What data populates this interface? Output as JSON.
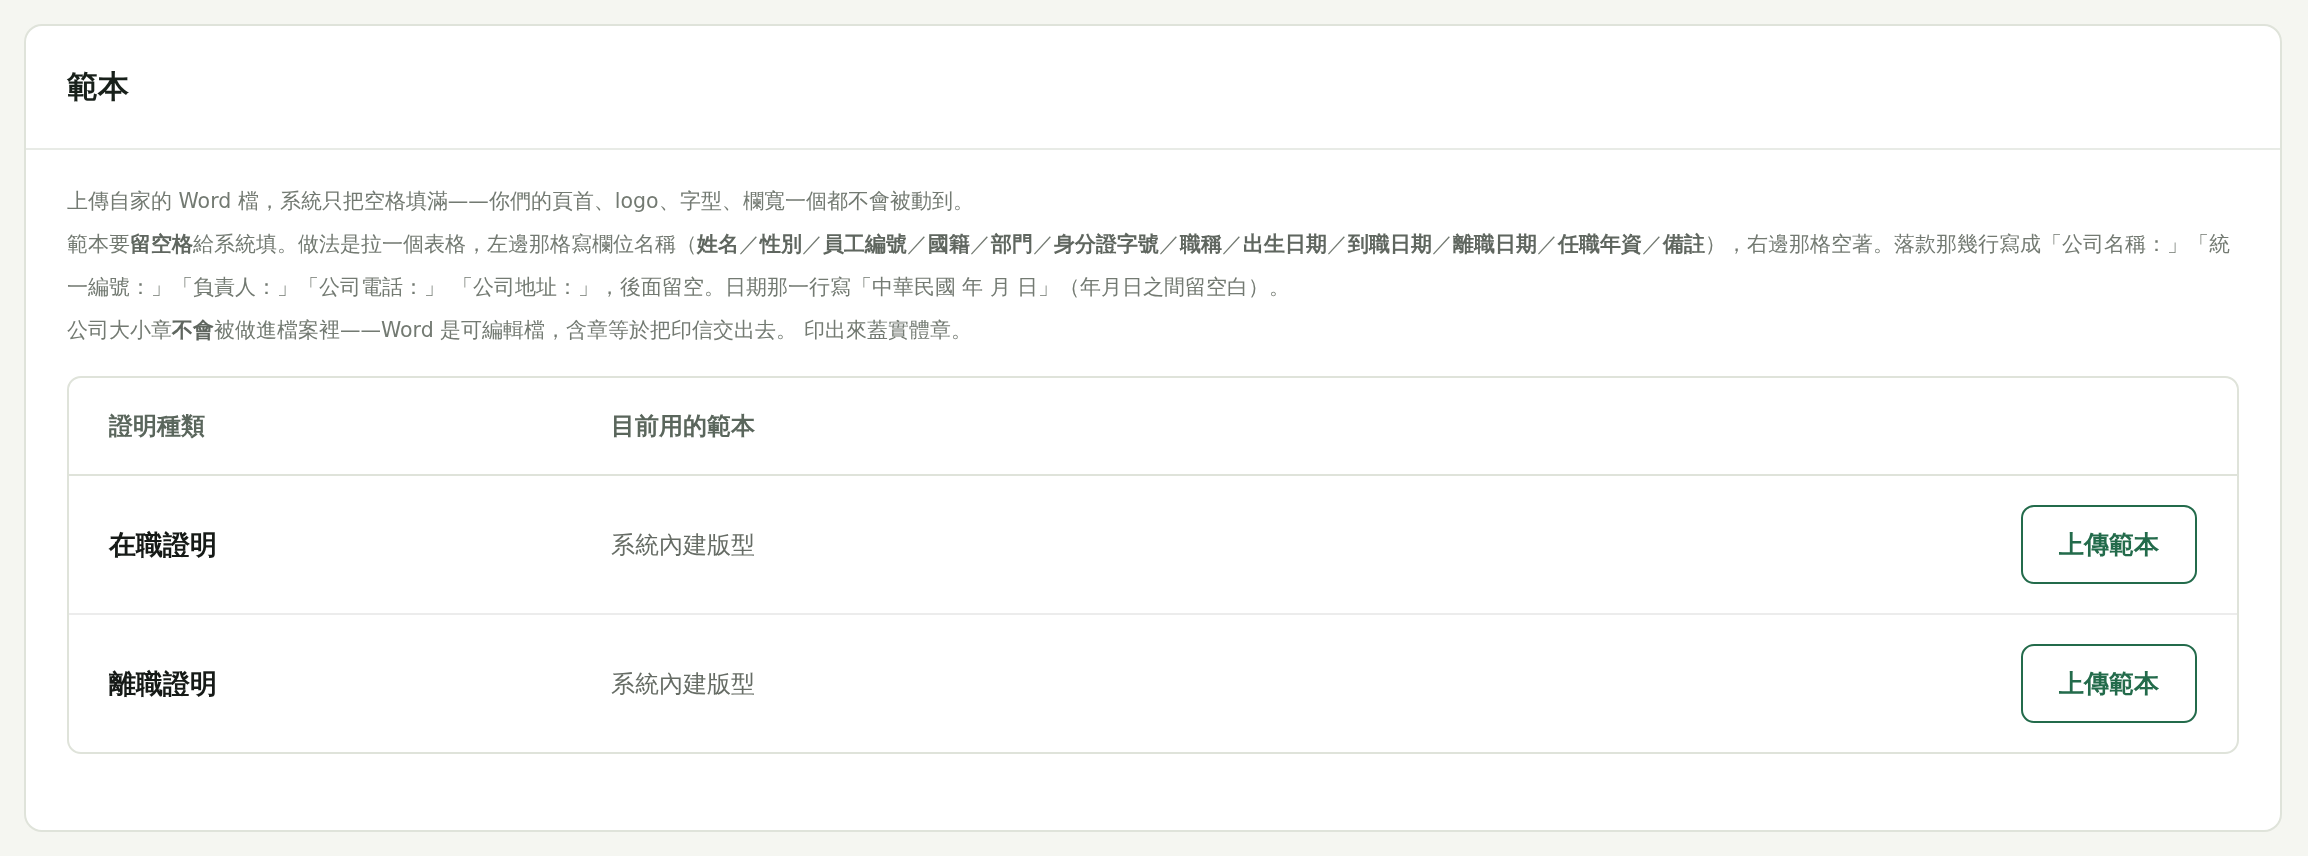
{
  "card": {
    "title": "範本"
  },
  "paragraphs": [
    "上傳自家的 Word 檔，系統只把空格填滿——你們的頁首、logo、字型、欄寬一個都不會被動到。",
    "範本要**留空格**給系統填。做法是拉一個表格，左邊那格寫欄位名稱（**姓名**／**性別**／**員工編號**／**國籍**／**部門**／**身分證字號**／**職稱**／**出生日期**／**到職日期**／**離職日期**／**任職年資**／**備註**），右邊那格空著。落款那幾行寫成「公司名稱：」「統一編號：」「負責人：」「公司電話：」 「公司地址：」，後面留空。日期那一行寫「中華民國 年 月 日」（年月日之間留空白）。",
    "公司大小章**不會**被做進檔案裡——Word 是可編輯檔，含章等於把印信交出去。 印出來蓋實體章。"
  ],
  "table": {
    "columns": [
      "證明種類",
      "目前用的範本"
    ],
    "rows": [
      {
        "type": "在職證明",
        "template": "系統內建版型",
        "button": "上傳範本"
      },
      {
        "type": "離職證明",
        "template": "系統內建版型",
        "button": "上傳範本"
      }
    ]
  }
}
